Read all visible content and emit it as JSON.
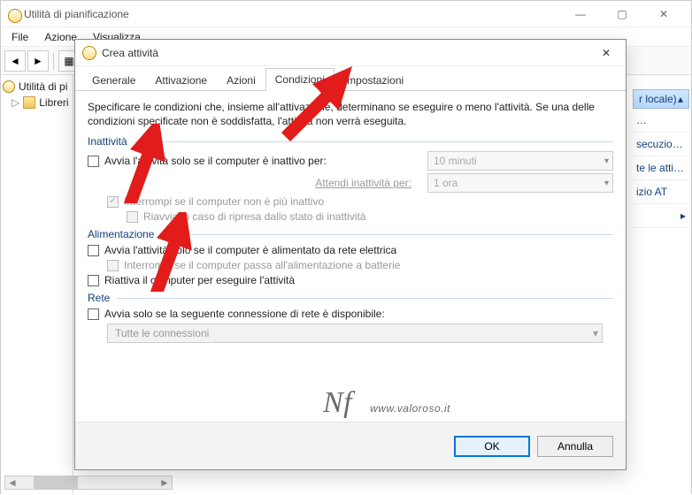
{
  "mainWindow": {
    "title": "Utilità di pianificazione",
    "menu": {
      "file": "File",
      "azione": "Azione",
      "visualizza": "Visualizza"
    }
  },
  "tree": {
    "root": "Utilità di pi",
    "lib": "Libreri"
  },
  "actionsPane": {
    "header": "r locale)",
    "items": [
      "…",
      "secuzio…",
      "te le atti…",
      "izio AT"
    ]
  },
  "dialog": {
    "title": "Crea attività",
    "tabs": {
      "generale": "Generale",
      "attivazione": "Attivazione",
      "azioni": "Azioni",
      "condizioni": "Condizioni",
      "impostazioni": "Impostazioni"
    },
    "desc": "Specificare le condizioni che, insieme all'attivazione, determinano se eseguire o meno l'attività. Se una delle condizioni specificate non è soddisfatta, l'attività non verrà eseguita.",
    "groups": {
      "inattivita": "Inattività",
      "alimentazione": "Alimentazione",
      "rete": "Rete"
    },
    "idle": {
      "start": "Avvia l'attività solo se il computer è inattivo per:",
      "waitLabel": "Attendi inattività per:",
      "stop": "Interrompi se il computer non è più inattivo",
      "restart": "Riavvia in caso di ripresa dallo stato di inattività",
      "idleFor": "10 minuti",
      "waitFor": "1 ora"
    },
    "power": {
      "acOnly": "Avvia l'attività solo se il computer è alimentato da rete elettrica",
      "stopBattery": "Interrompi se il computer passa all'alimentazione a batterie",
      "wake": "Riattiva il computer per eseguire l'attività"
    },
    "net": {
      "only": "Avvia solo se la seguente connessione di rete è disponibile:",
      "value": "Tutte le connessioni"
    },
    "buttons": {
      "ok": "OK",
      "cancel": "Annulla"
    }
  },
  "watermark": "www.valoroso.it"
}
